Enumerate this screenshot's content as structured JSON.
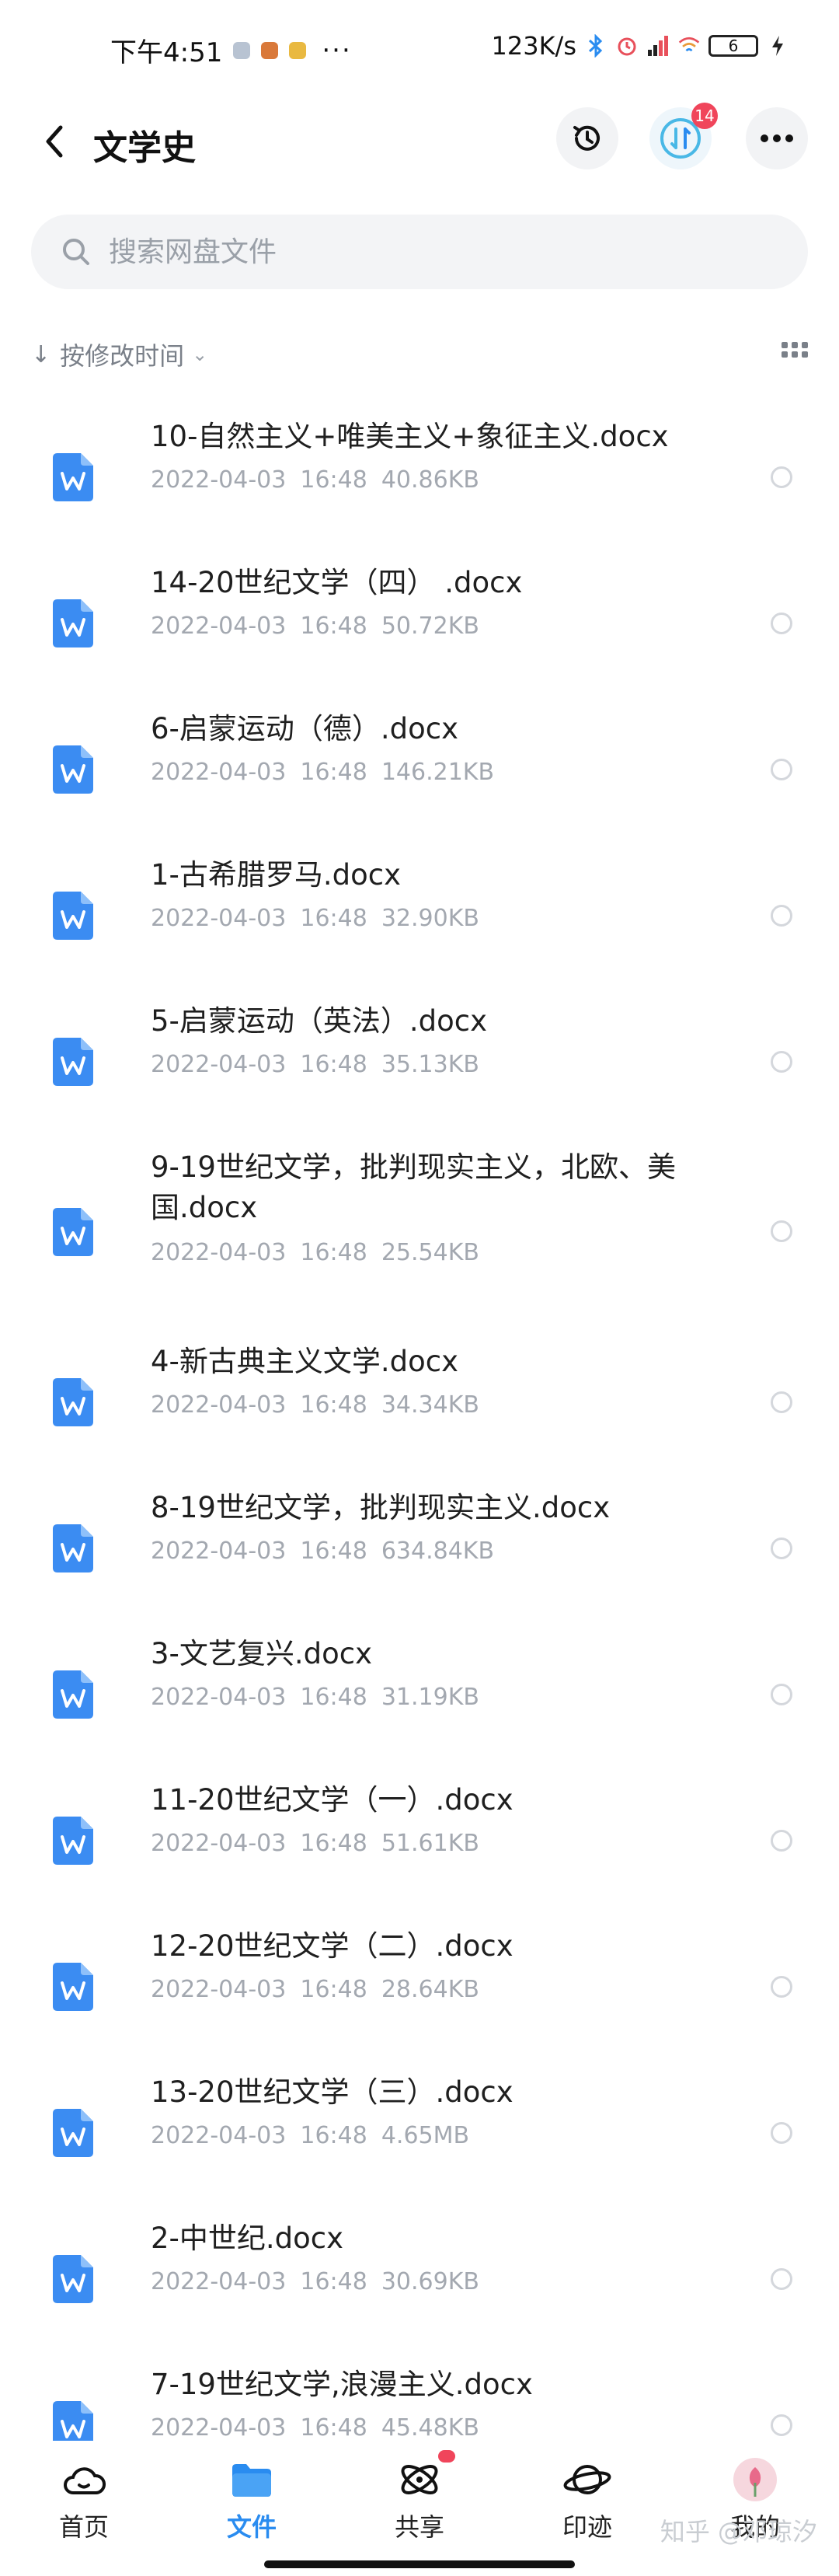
{
  "status_bar": {
    "time": "下午4:51",
    "dots": "···",
    "network_speed": "123K/s",
    "battery": "6"
  },
  "header": {
    "title": "文学史",
    "transfer_badge": "14"
  },
  "search": {
    "placeholder": "搜索网盘文件"
  },
  "sort": {
    "label": "按修改时间"
  },
  "files": [
    {
      "name": "10-自然主义+唯美主义+象征主义.docx",
      "date": "2022-04-03",
      "time": "16:48",
      "size": "40.86KB"
    },
    {
      "name": "14-20世纪文学（四） .docx",
      "date": "2022-04-03",
      "time": "16:48",
      "size": "50.72KB"
    },
    {
      "name": "6-启蒙运动（德）.docx",
      "date": "2022-04-03",
      "time": "16:48",
      "size": "146.21KB"
    },
    {
      "name": "1-古希腊罗马.docx",
      "date": "2022-04-03",
      "time": "16:48",
      "size": "32.90KB"
    },
    {
      "name": "5-启蒙运动（英法）.docx",
      "date": "2022-04-03",
      "time": "16:48",
      "size": "35.13KB"
    },
    {
      "name": "9-19世纪文学，批判现实主义，北欧、美国.docx",
      "date": "2022-04-03",
      "time": "16:48",
      "size": "25.54KB"
    },
    {
      "name": "4-新古典主义文学.docx",
      "date": "2022-04-03",
      "time": "16:48",
      "size": "34.34KB"
    },
    {
      "name": "8-19世纪文学，批判现实主义.docx",
      "date": "2022-04-03",
      "time": "16:48",
      "size": "634.84KB"
    },
    {
      "name": "3-文艺复兴.docx",
      "date": "2022-04-03",
      "time": "16:48",
      "size": "31.19KB"
    },
    {
      "name": "11-20世纪文学（一）.docx",
      "date": "2022-04-03",
      "time": "16:48",
      "size": "51.61KB"
    },
    {
      "name": "12-20世纪文学（二）.docx",
      "date": "2022-04-03",
      "time": "16:48",
      "size": "28.64KB"
    },
    {
      "name": "13-20世纪文学（三）.docx",
      "date": "2022-04-03",
      "time": "16:48",
      "size": "4.65MB"
    },
    {
      "name": "2-中世纪.docx",
      "date": "2022-04-03",
      "time": "16:48",
      "size": "30.69KB"
    },
    {
      "name": "7-19世纪文学,浪漫主义.docx",
      "date": "2022-04-03",
      "time": "16:48",
      "size": "45.48KB"
    }
  ],
  "bottom_nav": [
    {
      "label": "首页",
      "icon": "cloud-home-icon"
    },
    {
      "label": "文件",
      "icon": "folder-icon"
    },
    {
      "label": "共享",
      "icon": "share-icon"
    },
    {
      "label": "印迹",
      "icon": "planet-icon"
    },
    {
      "label": "我的",
      "icon": "avatar-icon"
    }
  ],
  "watermark": "知乎 @邓琼汐",
  "colors": {
    "accent": "#2a8cf0",
    "doc_icon": "#3b8cf2",
    "badge": "#f0455b"
  }
}
